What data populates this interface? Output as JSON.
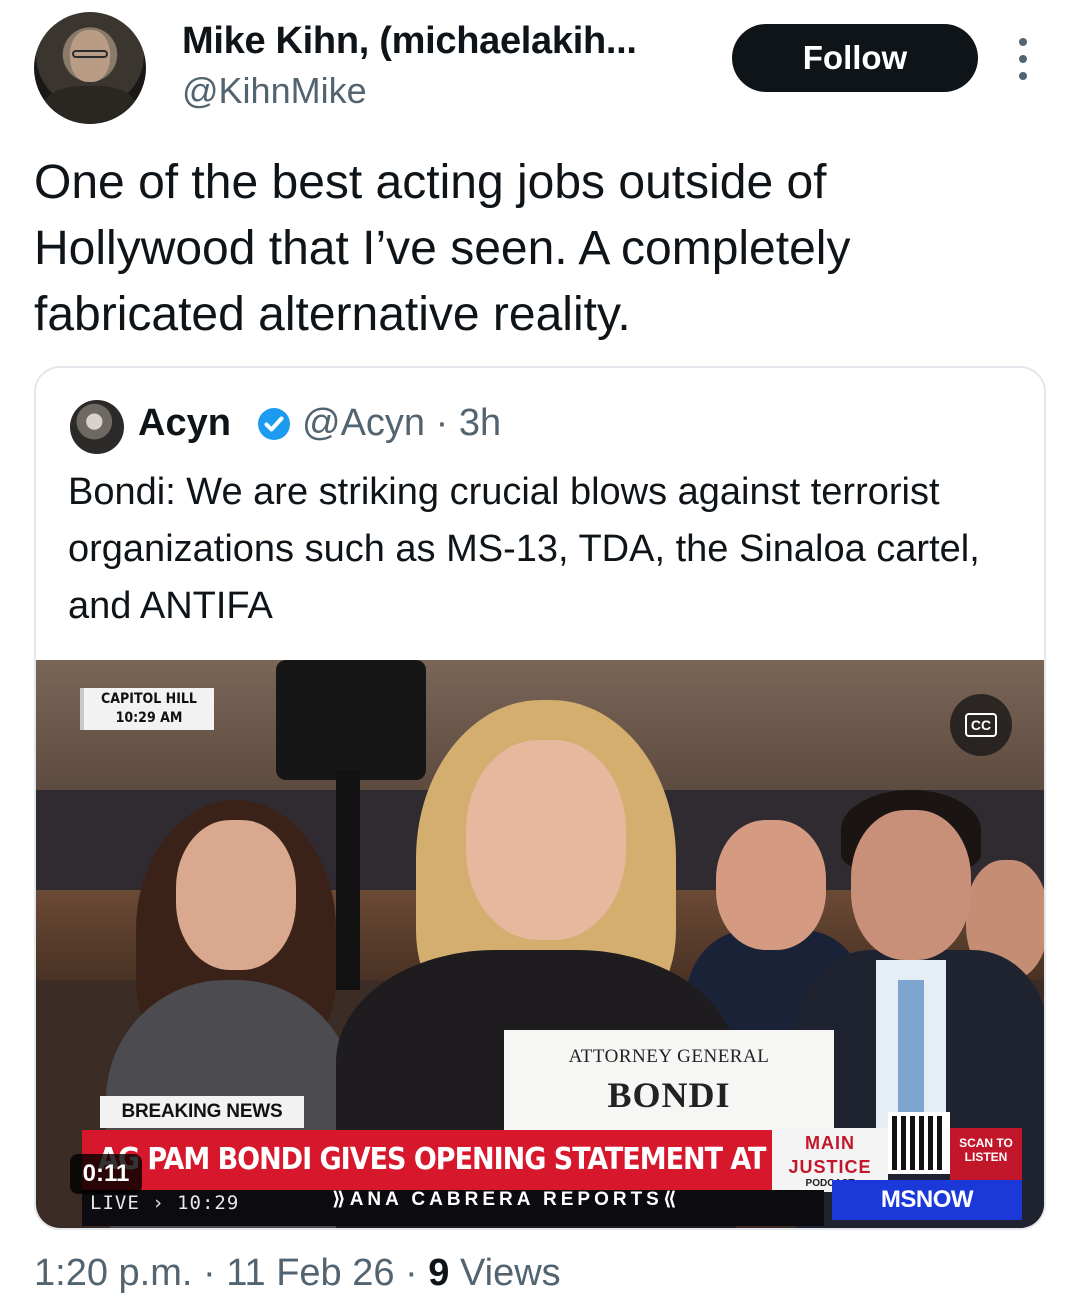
{
  "author": {
    "display_name": "Mike Kihn, (michaelakih...",
    "handle": "@KihnMike"
  },
  "follow_button": "Follow",
  "post_text": "One of the best acting jobs outside of Hollywood that I’ve seen. A completely fabricated alternative reality.",
  "quoted_post": {
    "display_name": "Acyn",
    "handle_time": "@Acyn · 3h",
    "verified_badge_color": "#1d9bf0",
    "text": "Bondi: We are striking crucial blows against terrorist organizations such as MS-13, TDA, the Sinaloa cartel, and ANTIFA",
    "video": {
      "location_bug_line1": "CAPITOL HILL",
      "location_bug_line2": "10:29 AM",
      "cc_label": "CC",
      "nameplate_title": "ATTORNEY GENERAL",
      "nameplate_name": "BONDI",
      "breaking_label": "BREAKING NEWS",
      "headline": "AG PAM BONDI GIVES OPENING STATEMENT AT HEARING",
      "main_justice_line1": "MAIN",
      "main_justice_line2": "JUSTICE",
      "main_justice_line3": "PODCAST",
      "scan_label_1": "SCAN TO",
      "scan_label_2": "LISTEN",
      "live_label": "LIVE › 10:29",
      "show_name": "⟫ANA CABRERA REPORTS⟪",
      "network": "MSNOW",
      "elapsed_time": "0:11",
      "ticker_color": "#d7172b",
      "network_color": "#1b39d8"
    }
  },
  "meta": {
    "time_date": "1:20 p.m. · 11 Feb 26 · ",
    "views_count": "9",
    "views_label": " Views"
  }
}
